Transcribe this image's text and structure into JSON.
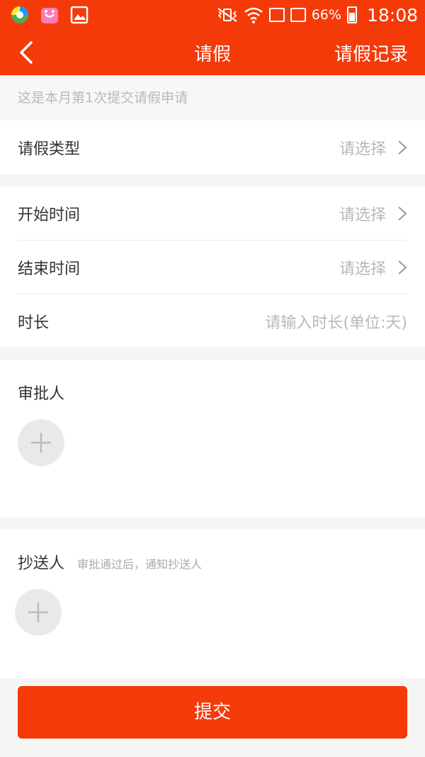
{
  "status_bar": {
    "battery": "66%",
    "time": "18:08"
  },
  "header": {
    "title": "请假",
    "right_link": "请假记录"
  },
  "notice": "这是本月第1次提交请假申请",
  "leave_type": {
    "label": "请假类型",
    "value": "请选择"
  },
  "time_section": {
    "start": {
      "label": "开始时间",
      "value": "请选择"
    },
    "end": {
      "label": "结束时间",
      "value": "请选择"
    },
    "duration": {
      "label": "时长",
      "placeholder": "请输入时长(单位:天)"
    }
  },
  "approver": {
    "label": "审批人"
  },
  "cc": {
    "label": "抄送人",
    "hint": "审批通过后，通知抄送人"
  },
  "submit_label": "提交",
  "colors": {
    "accent": "#f53a0a"
  }
}
